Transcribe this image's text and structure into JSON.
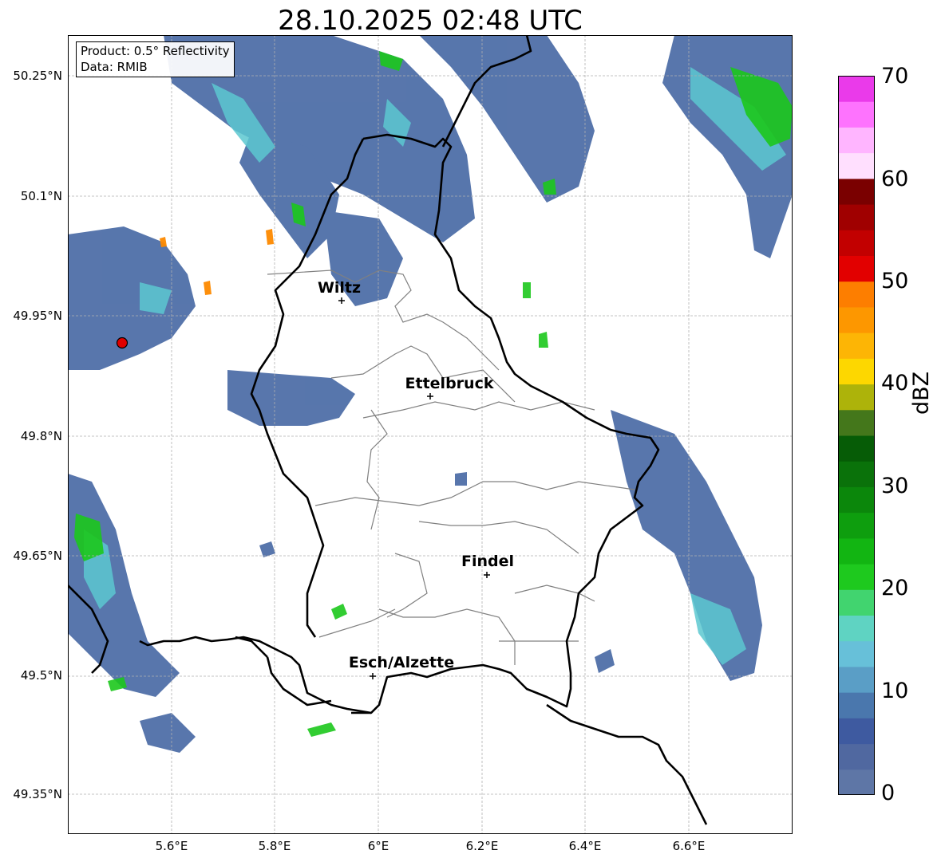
{
  "title": "28.10.2025 02:48 UTC",
  "info": {
    "product": "Product: 0.5° Reflectivity",
    "data_source": "Data: RMIB"
  },
  "axes": {
    "lat_labels": [
      "50.25°N",
      "50.1°N",
      "49.95°N",
      "49.8°N",
      "49.65°N",
      "49.5°N",
      "49.35°N"
    ],
    "lon_labels": [
      "5.6°E",
      "5.8°E",
      "6°E",
      "6.2°E",
      "6.4°E",
      "6.6°E"
    ],
    "grid": true
  },
  "colorbar": {
    "unit": "dBZ",
    "ticks": [
      "0",
      "10",
      "20",
      "30",
      "40",
      "50",
      "60",
      "70"
    ],
    "colors": [
      "#5e76a6",
      "#5068a0",
      "#3e5aa0",
      "#4a77ad",
      "#5a9ec6",
      "#67c0d9",
      "#5fd3c2",
      "#41d46f",
      "#1ec91e",
      "#12b512",
      "#0e9e0e",
      "#0b870b",
      "#0a720a",
      "#065c06",
      "#44771b",
      "#adb30a",
      "#fdd700",
      "#fdb505",
      "#fd9700",
      "#fd7e00",
      "#e20000",
      "#c20000",
      "#a00000",
      "#7a0000",
      "#ffdffe",
      "#ffb5ff",
      "#fe73fe",
      "#ea3aea"
    ]
  },
  "radar_site": {
    "marker": "radar-site-marker",
    "color": "#e00000"
  },
  "places": [
    {
      "name": "Wiltz"
    },
    {
      "name": "Ettelbruck"
    },
    {
      "name": "Findel"
    },
    {
      "name": "Esch/Alzette"
    }
  ],
  "colors": {
    "border": "#000000",
    "canton_lines": "#808080",
    "grid": "#b0b0b0"
  }
}
